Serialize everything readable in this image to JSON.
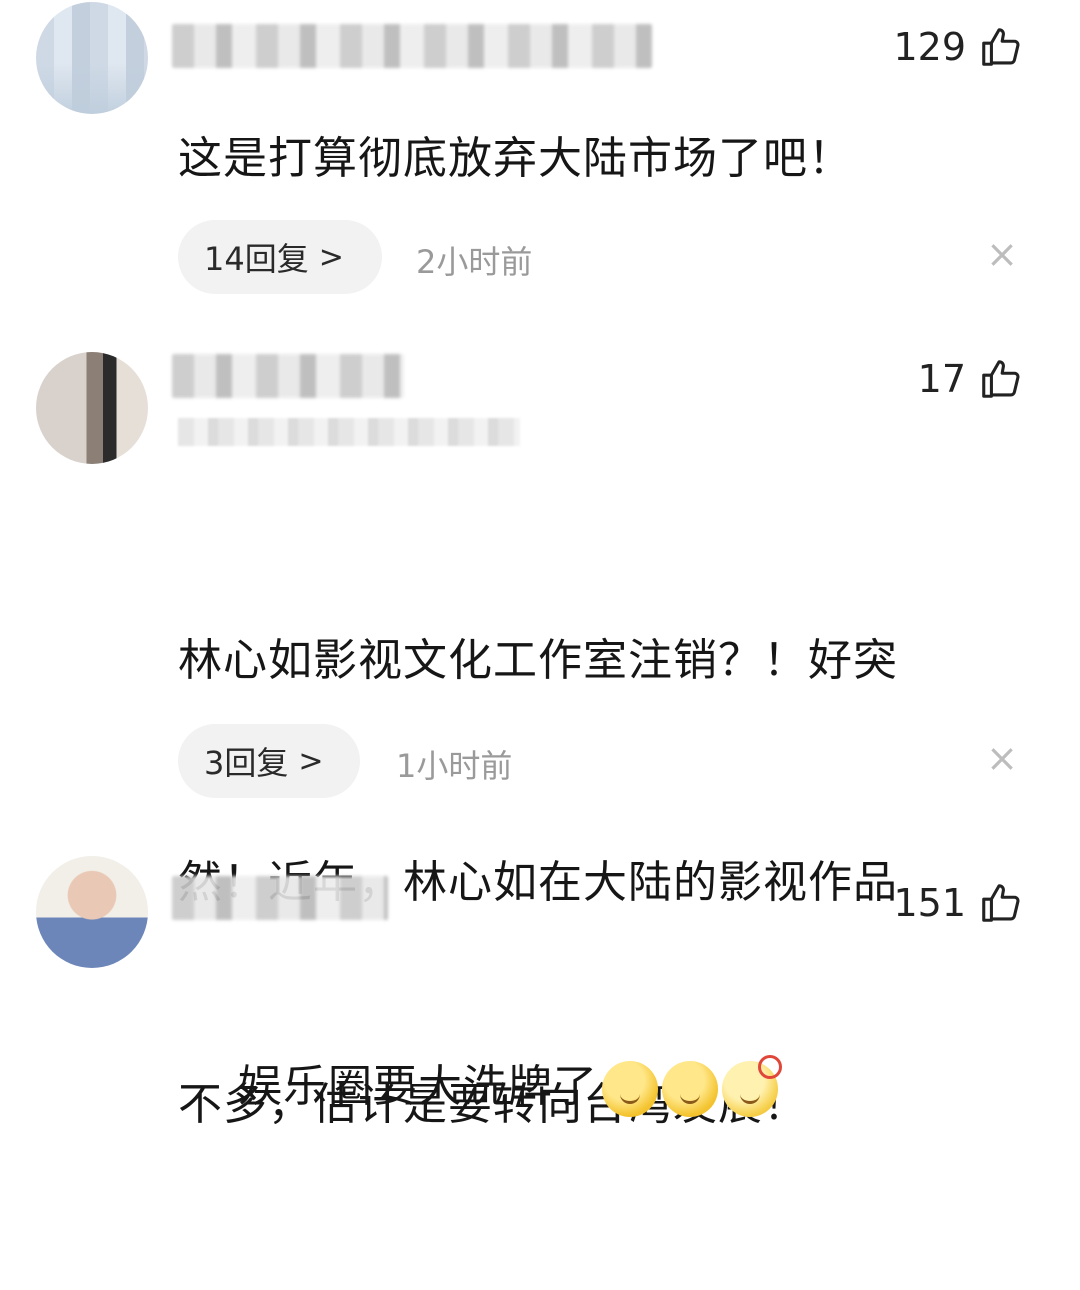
{
  "comments": [
    {
      "likes": "129",
      "text": "这是打算彻底放弃大陆市场了吧！",
      "replies_label": "14回复",
      "time": "2小时前"
    },
    {
      "likes": "17",
      "text": "林心如影视文化工作室注销？！好突然！近年，林心如在大陆的影视作品不多，估计是要转向台湾发展！",
      "text_lines": [
        "林心如影视文化工作室注销？！好突",
        "然！近年，林心如在大陆的影视作品",
        "不多，估计是要转向台湾发展！"
      ],
      "replies_label": "3回复",
      "time": "1小时前"
    },
    {
      "likes": "151",
      "text": "娱乐圈要大洗牌了",
      "emojis": [
        "hot-face-emoji",
        "hot-face-emoji",
        "dizzy-face-emoji"
      ]
    }
  ],
  "icons": {
    "like": "thumbs-up-outline-icon",
    "close": "close-icon",
    "chevron": "chevron-right-icon"
  },
  "glyphs": {
    "chevron": ">",
    "close": "×"
  }
}
